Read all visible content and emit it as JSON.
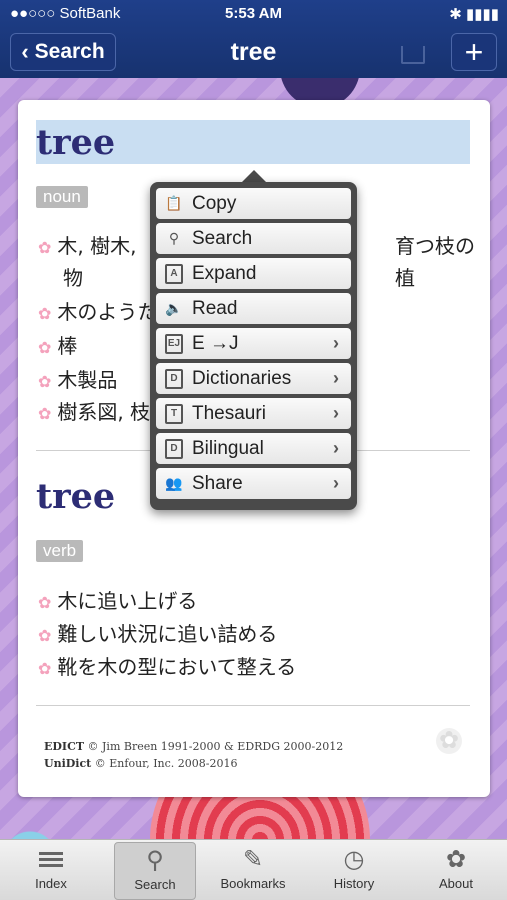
{
  "status": {
    "carrier": "●●○○○ SoftBank",
    "time": "5:53 AM",
    "right": "✱ ▮▮▮▮"
  },
  "nav": {
    "back_label": "Search",
    "title": "tree",
    "add_label": "+"
  },
  "entries": [
    {
      "headword": "tree",
      "pos": "noun",
      "senses": [
        "木, 樹木,",
        "物",
        "木のようた",
        "棒",
        "木製品",
        "樹系図, 枝"
      ],
      "sense_tail": "育つ枝の植"
    },
    {
      "headword": "tree",
      "pos": "verb",
      "senses": [
        "木に追い上げる",
        "難しい状況に追い詰める",
        "靴を木の型において整える"
      ]
    }
  ],
  "credits": {
    "line1_name": "EDICT",
    "line1_rest": "© Jim Breen 1991-2000 & EDRDG 2000-2012",
    "line2_name": "UniDict",
    "line2_rest": "© Enfour, Inc. 2008-2016"
  },
  "menu": [
    {
      "label": "Copy",
      "icon": "clipboard-icon"
    },
    {
      "label": "Search",
      "icon": "search-icon"
    },
    {
      "label": "Expand",
      "icon": "expand-icon"
    },
    {
      "label": "Read",
      "icon": "speaker-icon"
    },
    {
      "label": "E →J",
      "icon": "ej-icon",
      "has_submenu": true
    },
    {
      "label": "Dictionaries",
      "icon": "dictionary-icon",
      "has_submenu": true
    },
    {
      "label": "Thesauri",
      "icon": "thesaurus-icon",
      "has_submenu": true
    },
    {
      "label": "Bilingual",
      "icon": "bilingual-icon",
      "has_submenu": true
    },
    {
      "label": "Share",
      "icon": "share-people-icon",
      "has_submenu": true
    }
  ],
  "tabs": [
    {
      "label": "Index",
      "icon": "list-icon"
    },
    {
      "label": "Search",
      "icon": "search-icon",
      "active": true
    },
    {
      "label": "Bookmarks",
      "icon": "bookmark-icon"
    },
    {
      "label": "History",
      "icon": "clock-icon"
    },
    {
      "label": "About",
      "icon": "flower-icon"
    }
  ]
}
